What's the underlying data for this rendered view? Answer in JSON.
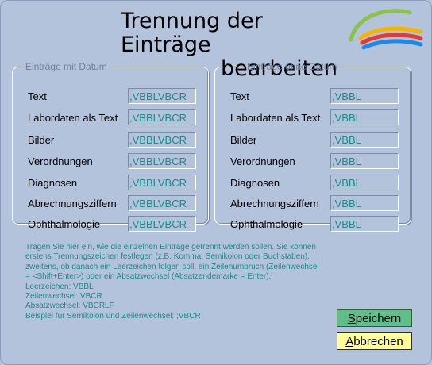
{
  "title": {
    "line1": "Trennung der Einträge",
    "line2": "bearbeiten"
  },
  "logo": {
    "icon": "swoosh-logo-icon",
    "colors": [
      "#8bc34a",
      "#f4b400",
      "#e53935",
      "#1e88e5"
    ]
  },
  "with_date": {
    "legend": "Einträge mit Datum",
    "rows": [
      {
        "label": "Text",
        "value": ",VBBLVBCR"
      },
      {
        "label": "Labordaten als Text",
        "value": ",VBBLVBCR"
      },
      {
        "label": "Bilder",
        "value": ",VBBLVBCR"
      },
      {
        "label": "Verordnungen",
        "value": ",VBBLVBCR"
      },
      {
        "label": "Diagnosen",
        "value": ",VBBLVBCR"
      },
      {
        "label": "Abrechnungsziffern",
        "value": ",VBBLVBCR"
      },
      {
        "label": "Ophthalmologie",
        "value": ",VBBLVBCR"
      }
    ]
  },
  "without_date": {
    "legend": "Einträge ohne Datum",
    "rows": [
      {
        "label": "Text",
        "value": ",VBBL"
      },
      {
        "label": "Labordaten als Text",
        "value": ",VBBL"
      },
      {
        "label": "Bilder",
        "value": ",VBBL"
      },
      {
        "label": "Verordnungen",
        "value": ",VBBL"
      },
      {
        "label": "Diagnosen",
        "value": ",VBBL"
      },
      {
        "label": "Abrechnungsziffern",
        "value": ",VBBL"
      },
      {
        "label": "Ophthalmologie",
        "value": ",VBBL"
      }
    ]
  },
  "help": {
    "intro": "Tragen Sie hier ein, wie die einzelnen Einträge getrennt werden sollen. Sie können erstens Trennungszeichen festlegen (z.B. Komma, Semikolon oder Buchstaben), zweitens, ob danach ein Leerzeichen folgen soll, ein Zeilenumbruch (Zeilenwechsel = <Shift+Enter>) oder ein Absatzwechsel (Absatzendemarke = Enter).",
    "space": "Leerzeichen: VBBL",
    "linebreak": "Zeilenwechsel: VBCR",
    "paragraph": "Absatzwechsel: VBCRLF",
    "example": "Beispiel für Semikolon und Zeilenwechsel: ;VBCR"
  },
  "buttons": {
    "save": {
      "accel": "S",
      "rest": "peichern"
    },
    "cancel": {
      "accel": "A",
      "rest": "bbrechen"
    }
  },
  "colors": {
    "background": "#b3c3dc",
    "value_text": "#1f8a8a",
    "save_button": "#5fbf8c",
    "cancel_button": "#ffff9a"
  }
}
